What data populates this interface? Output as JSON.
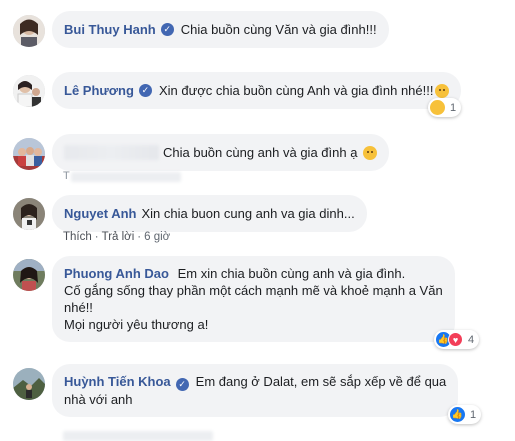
{
  "comments": [
    {
      "author": "Bui Thuy Hanh",
      "text": "Chia buồn cùng Văn và gia đình!!!"
    },
    {
      "author": "Lê Phương",
      "text": "Xin được chia buồn cùng Anh và gia đình nhé!!!",
      "reaction_count": "1"
    },
    {
      "author": "",
      "text": "Chia buồn cùng anh và gia đình ạ",
      "below_mark": "T"
    },
    {
      "author": "Nguyet Anh",
      "text": "Xin chia buon cung anh va gia dinh...",
      "actions": {
        "like": "Thích",
        "reply": "Trả lời",
        "time": "6 giờ"
      }
    },
    {
      "author": "Phuong Anh Dao",
      "text_lines": [
        "Em xin chia buồn cùng anh và gia đình.",
        "Cố gắng sống thay phần một cách mạnh mẽ và khoẻ mạnh a Văn",
        "nhé!!",
        "Mọi người yêu thương a!"
      ],
      "reaction_count": "4"
    },
    {
      "author": "Huỳnh Tiến Khoa",
      "text_lines": [
        "Em đang ở Dalat, em sẽ sắp xếp về để qua",
        "nhà với anh"
      ],
      "reaction_count": "1"
    }
  ],
  "verified_glyph": "✓",
  "separator": "·",
  "colors": {
    "name": "#385898",
    "bubble": "#f2f3f5",
    "like": "#1877f2",
    "love": "#f33e58",
    "verified": "#4267b2"
  },
  "icons": [
    "verified-badge-icon",
    "sad-face-emoji-icon",
    "like-reaction-icon",
    "love-reaction-icon",
    "sad-reaction-icon"
  ]
}
